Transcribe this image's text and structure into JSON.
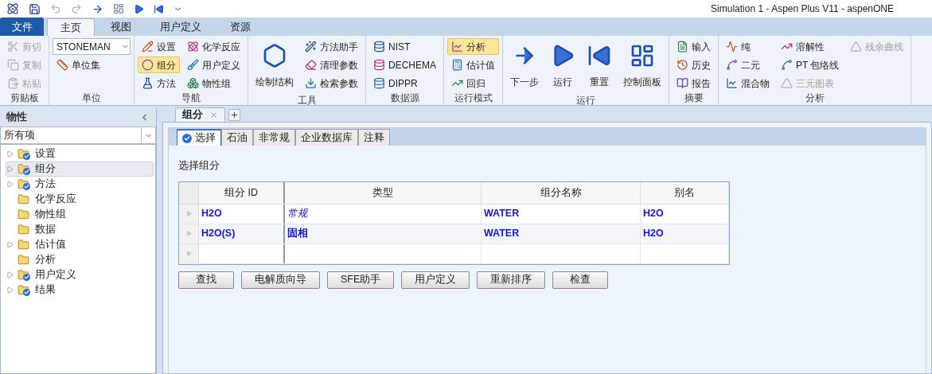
{
  "window": {
    "title": "Simulation 1 - Aspen Plus V11 - aspenONE"
  },
  "ribbon_tabs": [
    {
      "label": "文件",
      "kind": "file",
      "selected": false
    },
    {
      "label": "主页",
      "kind": "tab",
      "selected": true
    },
    {
      "label": "视图",
      "kind": "tab",
      "selected": false
    },
    {
      "label": "用户定义",
      "kind": "tab",
      "selected": false
    },
    {
      "label": "资源",
      "kind": "tab",
      "selected": false
    }
  ],
  "ribbon_groups": [
    {
      "label": "剪贴板",
      "items": [
        {
          "kind": "small",
          "label": "剪切",
          "disabled": true,
          "selected": false
        },
        {
          "kind": "small",
          "label": "复制",
          "disabled": true,
          "selected": false
        },
        {
          "kind": "small",
          "label": "粘贴",
          "disabled": true,
          "selected": false
        }
      ]
    },
    {
      "label": "单位",
      "items": [
        {
          "kind": "dropdown",
          "label": "STONEMAN",
          "disabled": false,
          "selected": false
        },
        {
          "kind": "small",
          "label": "单位集",
          "disabled": false,
          "selected": false
        }
      ]
    },
    {
      "label": "导航",
      "items": [
        {
          "kind": "small",
          "label": "设置",
          "disabled": false,
          "selected": false
        },
        {
          "kind": "small",
          "label": "组分",
          "disabled": false,
          "selected": true
        },
        {
          "kind": "small",
          "label": "方法",
          "disabled": false,
          "selected": false
        },
        {
          "kind": "small",
          "label": "化学反应",
          "disabled": false,
          "selected": false
        },
        {
          "kind": "small",
          "label": "用户定义",
          "disabled": false,
          "selected": false
        },
        {
          "kind": "small",
          "label": "物性组",
          "disabled": false,
          "selected": false
        }
      ]
    },
    {
      "label": "工具",
      "items": [
        {
          "kind": "large",
          "label": "绘制结构",
          "disabled": false,
          "selected": false
        },
        {
          "kind": "small",
          "label": "方法助手",
          "disabled": false,
          "selected": false
        },
        {
          "kind": "small",
          "label": "清理参数",
          "disabled": false,
          "selected": false
        },
        {
          "kind": "small",
          "label": "检索参数",
          "disabled": false,
          "selected": false
        }
      ]
    },
    {
      "label": "数据源",
      "items": [
        {
          "kind": "small",
          "label": "NIST",
          "disabled": false,
          "selected": false
        },
        {
          "kind": "small",
          "label": "DECHEMA",
          "disabled": false,
          "selected": false
        },
        {
          "kind": "small",
          "label": "DIPPR",
          "disabled": false,
          "selected": false
        }
      ]
    },
    {
      "label": "运行模式",
      "items": [
        {
          "kind": "small",
          "label": "分析",
          "disabled": false,
          "selected": true
        },
        {
          "kind": "small",
          "label": "估计值",
          "disabled": false,
          "selected": false
        },
        {
          "kind": "small",
          "label": "回归",
          "disabled": false,
          "selected": false
        }
      ]
    },
    {
      "label": "运行",
      "items": [
        {
          "kind": "large",
          "label": "下一步",
          "disabled": false,
          "selected": false
        },
        {
          "kind": "large",
          "label": "运行",
          "disabled": false,
          "selected": false
        },
        {
          "kind": "large",
          "label": "重置",
          "disabled": false,
          "selected": false
        },
        {
          "kind": "large",
          "label": "控制面板",
          "disabled": false,
          "selected": false
        }
      ]
    },
    {
      "label": "摘要",
      "items": [
        {
          "kind": "small",
          "label": "输入",
          "disabled": false,
          "selected": false
        },
        {
          "kind": "small",
          "label": "历史",
          "disabled": false,
          "selected": false
        },
        {
          "kind": "small",
          "label": "报告",
          "disabled": false,
          "selected": false
        }
      ]
    },
    {
      "label": "分析",
      "items": [
        {
          "kind": "small",
          "label": "纯",
          "disabled": false,
          "selected": false
        },
        {
          "kind": "small",
          "label": "二元",
          "disabled": false,
          "selected": false
        },
        {
          "kind": "small",
          "label": "混合物",
          "disabled": false,
          "selected": false
        },
        {
          "kind": "small",
          "label": "溶解性",
          "disabled": false,
          "selected": false
        },
        {
          "kind": "small",
          "label": "PT 包络线",
          "disabled": false,
          "selected": false
        },
        {
          "kind": "small",
          "label": "三元图表",
          "disabled": true,
          "selected": false
        },
        {
          "kind": "small",
          "label": "残余曲线",
          "disabled": true,
          "selected": false
        }
      ]
    }
  ],
  "sidebar": {
    "title": "物性",
    "filter": {
      "value": "所有项"
    },
    "items": [
      {
        "label": "设置",
        "expandable": true,
        "checked": true,
        "selected": false
      },
      {
        "label": "组分",
        "expandable": true,
        "checked": true,
        "selected": true
      },
      {
        "label": "方法",
        "expandable": true,
        "checked": true,
        "selected": false
      },
      {
        "label": "化学反应",
        "expandable": false,
        "checked": false,
        "selected": false
      },
      {
        "label": "物性组",
        "expandable": false,
        "checked": false,
        "selected": false
      },
      {
        "label": "数据",
        "expandable": false,
        "checked": false,
        "selected": false
      },
      {
        "label": "估计值",
        "expandable": true,
        "checked": false,
        "selected": false
      },
      {
        "label": "分析",
        "expandable": false,
        "checked": false,
        "selected": false
      },
      {
        "label": "用户定义",
        "expandable": true,
        "checked": true,
        "selected": false
      },
      {
        "label": "结果",
        "expandable": true,
        "checked": true,
        "selected": false
      }
    ]
  },
  "document_tabs": [
    {
      "label": "组分",
      "selected": true
    }
  ],
  "form_tabs": [
    {
      "label": "选择",
      "checked": true,
      "selected": true
    },
    {
      "label": "石油",
      "checked": false,
      "selected": false
    },
    {
      "label": "非常规",
      "checked": false,
      "selected": false
    },
    {
      "label": "企业数据库",
      "checked": false,
      "selected": false
    },
    {
      "label": "注释",
      "checked": false,
      "selected": false
    }
  ],
  "section_title": "选择组分",
  "table": {
    "columns": [
      "组分 ID",
      "类型",
      "组分名称",
      "别名"
    ],
    "rows": [
      {
        "cells": [
          "H2O",
          "常规",
          "WATER",
          "H2O"
        ],
        "type_italic": true
      },
      {
        "cells": [
          "H2O(S)",
          "固相",
          "WATER",
          "H2O"
        ],
        "type_italic": false
      }
    ]
  },
  "buttons": [
    "查找",
    "电解质向导",
    "SFE助手",
    "用户定义",
    "重新排序",
    "检查"
  ]
}
